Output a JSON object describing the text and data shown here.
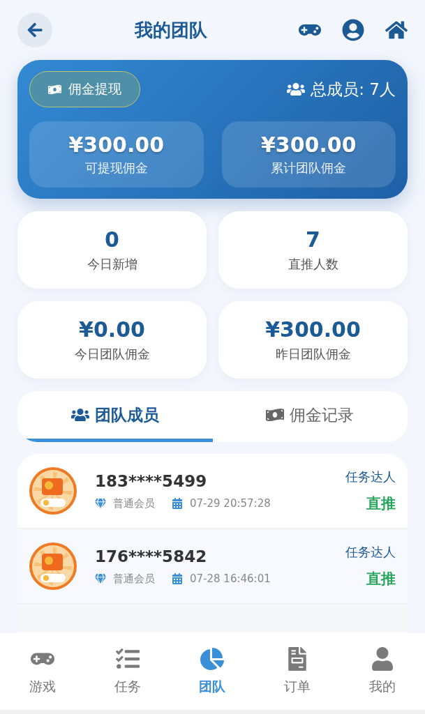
{
  "header": {
    "title": "我的团队"
  },
  "summary": {
    "withdraw_button": "佣金提现",
    "total_members": "总成员: 7人",
    "balances": [
      {
        "amount": "¥300.00",
        "label": "可提现佣金"
      },
      {
        "amount": "¥300.00",
        "label": "累计团队佣金"
      }
    ]
  },
  "stats": [
    {
      "value": "0",
      "label": "今日新增"
    },
    {
      "value": "7",
      "label": "直推人数"
    },
    {
      "value": "¥0.00",
      "label": "今日团队佣金"
    },
    {
      "value": "¥300.00",
      "label": "昨日团队佣金"
    }
  ],
  "tabs": [
    {
      "kind": "members",
      "label": "团队成员",
      "selected": true
    },
    {
      "kind": "commission",
      "label": "佣金记录",
      "selected": false
    }
  ],
  "members": [
    {
      "phone": "183****5499",
      "level": "普通会员",
      "joined": "07-29 20:57:28",
      "title": "任务达人",
      "relation": "直推"
    },
    {
      "phone": "176****5842",
      "level": "普通会员",
      "joined": "07-28 16:46:01",
      "title": "任务达人",
      "relation": "直推"
    }
  ],
  "nav": [
    {
      "kind": "games",
      "label": "游戏",
      "selected": false
    },
    {
      "kind": "tasks",
      "label": "任务",
      "selected": false
    },
    {
      "kind": "team",
      "label": "团队",
      "selected": true
    },
    {
      "kind": "orders",
      "label": "订单",
      "selected": false
    },
    {
      "kind": "me",
      "label": "我的",
      "selected": false
    }
  ]
}
